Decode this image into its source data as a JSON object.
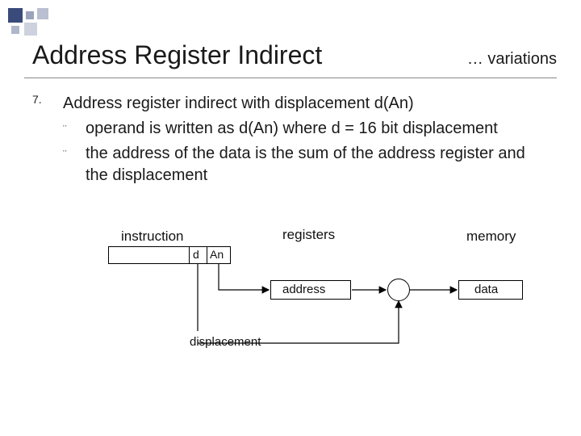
{
  "header": {
    "title": "Address Register Indirect",
    "subtitle": "… variations"
  },
  "list": {
    "number": "7.",
    "lead": "Address register indirect with displacement d(An)",
    "sub1_bullet": "¨",
    "sub1_text": "operand is written as d(An) where d = 16 bit displacement",
    "sub2_bullet": "¨",
    "sub2_text": "the address of the data is the sum of the address register and the displacement"
  },
  "diagram": {
    "instruction_label": "instruction",
    "registers_label": "registers",
    "memory_label": "memory",
    "d_label": "d",
    "an_label": "An",
    "address_label": "address",
    "displacement_label": "displacement",
    "data_label": "data"
  }
}
